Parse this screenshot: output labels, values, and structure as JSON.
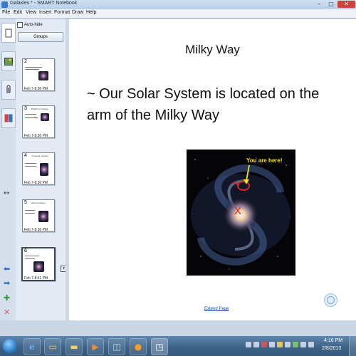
{
  "window": {
    "title": "Galaxies * - SMART Notebook",
    "minimize": "–",
    "maximize": "□",
    "close": "✕"
  },
  "menu": [
    "File",
    "Edit",
    "View",
    "Insert",
    "Format",
    "Draw",
    "Help"
  ],
  "sorter": {
    "autohide_label": "Auto-hide",
    "groups_label": "Groups",
    "pages": [
      {
        "number": "2",
        "date": "Feb 7-8:36 PM",
        "title": ""
      },
      {
        "number": "3",
        "date": "Feb 7-8:36 PM",
        "title": "Elliptical Galaxy"
      },
      {
        "number": "4",
        "date": "Feb 7-8:36 PM",
        "title": "Irregular Galaxy"
      },
      {
        "number": "5",
        "date": "Feb 7-8:36 PM",
        "title": "Spiral Galaxy"
      },
      {
        "number": "6",
        "date": "Feb 7-8:41 PM",
        "title": ""
      }
    ]
  },
  "page": {
    "title": "Milky Way",
    "body": "~ Our Solar System is located on the arm of the Milky Way",
    "image_label": "You are here!",
    "marker": "X",
    "extend_link": "Extend Page"
  },
  "taskbar": {
    "time": "4:16 PM",
    "date": "2/8/2013"
  },
  "colors": {
    "accent": "#3a78c9",
    "annotation_red": "#e02020",
    "label_yellow": "#f2e21a"
  }
}
